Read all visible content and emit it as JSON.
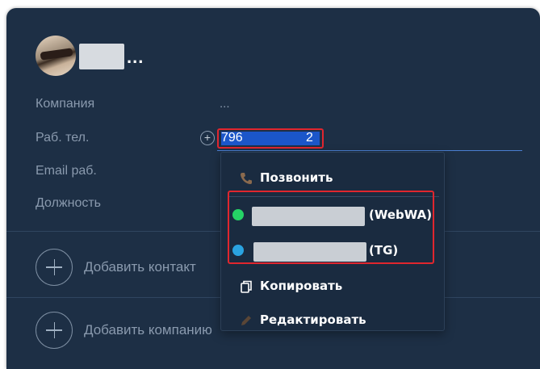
{
  "contact": {
    "name_suffix": "..."
  },
  "fields": {
    "company_label": "Компания",
    "company_value": "...",
    "work_phone_label": "Раб. тел.",
    "work_phone_prefix": "796",
    "work_phone_suffix": "2",
    "add_phone_symbol": "+",
    "email_label": "Email раб.",
    "position_label": "Должность"
  },
  "actions": {
    "add_contact": "Добавить контакт",
    "add_company": "Добавить компанию"
  },
  "menu": {
    "call": "Позвонить",
    "whatsapp_tag": "(WebWA)",
    "telegram_tag": "(TG)",
    "copy": "Копировать",
    "edit": "Редактировать"
  },
  "colors": {
    "card_bg": "#1d2f45",
    "selection": "#1b56c9",
    "highlight_border": "#e0262e",
    "whatsapp": "#25d366",
    "telegram": "#2aa3e0"
  }
}
